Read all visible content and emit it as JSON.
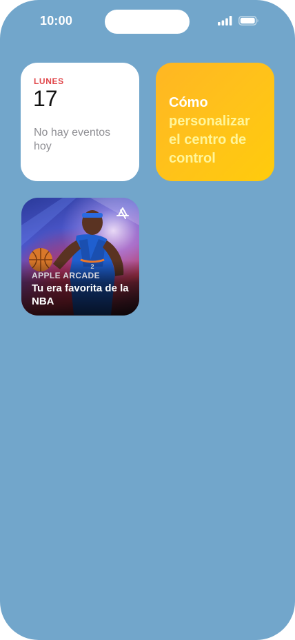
{
  "status_bar": {
    "time": "10:00",
    "icons": [
      "cellular-signal-icon",
      "battery-icon"
    ]
  },
  "calendar_widget": {
    "weekday": "LUNES",
    "day": "17",
    "events_text": "No hay eventos hoy",
    "accent_color": "#e0464a"
  },
  "tips_widget": {
    "line1": "Cómo",
    "rest": "personalizar el centro de control",
    "colors": {
      "background": "#ffc21a",
      "line1": "#ffffff",
      "rest": "#fff59a"
    }
  },
  "arcade_widget": {
    "label": "APPLE ARCADE",
    "title": "Tu era favorita de la NBA",
    "icon": "app-store-icon"
  },
  "colors": {
    "wallpaper": "#72a6cb"
  }
}
